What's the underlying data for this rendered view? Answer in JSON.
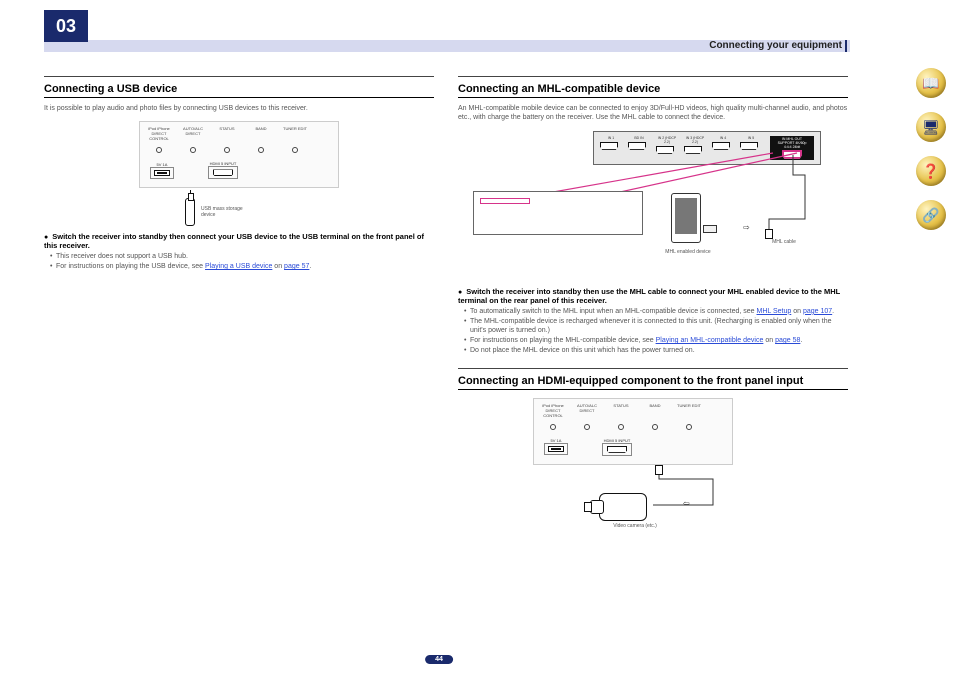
{
  "header": {
    "chapter_num": "03",
    "chapter_title": "Connecting your equipment"
  },
  "page_number": "44",
  "left": {
    "h_usb": "Connecting a USB device",
    "usb_intro": "It is possible to play audio and photo files by connecting USB devices to this receiver.",
    "usb_diagram": {
      "ports": [
        "iPod iPhone DIRECT CONTROL",
        "AUTO/ALC DIRECT",
        "STATUS",
        "BAND",
        "TUNER EDIT"
      ],
      "usb_label": "5V 1A",
      "hdmi_label": "HDMI 5 INPUT",
      "device_caption": "USB mass storage device"
    },
    "usb_bold": "Switch the receiver into standby then connect your USB device to the USB terminal on the front panel of this receiver.",
    "usb_notes": [
      {
        "pre": "This receiver does not support a USB hub."
      },
      {
        "pre": "For instructions on playing the USB device, see ",
        "link": "Playing a USB device",
        "mid": " on ",
        "link2": "page 57",
        "post": "."
      }
    ]
  },
  "right": {
    "h_mhl": "Connecting an MHL-compatible device",
    "mhl_intro": "An MHL-compatible mobile device can be connected to enjoy 3D/Full-HD videos, high quality multi-channel audio, and photos etc., with charge the battery on the receiver. Use the MHL cable to connect the device.",
    "mhl_diagram": {
      "ports": [
        "IN 1",
        "BD IN",
        "IN 2 (HDCP 2.2)",
        "IN 3 (HDCP 2.2)",
        "IN 4",
        "IN 5"
      ],
      "mhl_port_label": "IN   MHL  OUT\nSUPPORT 4K/60p\n4:4:4 24bit",
      "phone_caption": "MHL enabled device",
      "cable_caption": "MHL cable"
    },
    "mhl_bold": "Switch the receiver into standby then use the MHL cable to connect your MHL enabled device to the MHL terminal on the rear panel of this receiver.",
    "mhl_notes": [
      {
        "pre": "To automatically switch to the MHL input when an MHL-compatible device is connected, see ",
        "link": "MHL Setup",
        "mid": " on ",
        "link2": "page 107",
        "post": "."
      },
      {
        "pre": "The MHL-compatible device is recharged whenever it is connected to this unit. (Recharging is enabled only when the unit's power is turned on.)"
      },
      {
        "pre": "For instructions on playing the MHL-compatible device, see ",
        "link": "Playing an MHL-compatible device",
        "mid": " on ",
        "link2": "page 58",
        "post": "."
      },
      {
        "pre": "Do not place the MHL device on this unit which has the power turned on."
      }
    ],
    "h_hdmi": "Connecting an HDMI-equipped component to the front panel input",
    "hdmi_diagram": {
      "ports": [
        "iPod iPhone DIRECT CONTROL",
        "AUTO/ALC DIRECT",
        "STATUS",
        "BAND",
        "TUNER EDIT"
      ],
      "usb_label": "5V 1A",
      "hdmi_label": "HDMI 5 INPUT",
      "device_caption": "Video camera (etc.)"
    }
  },
  "sidebar": {
    "icons": [
      "book-icon",
      "register-icon",
      "help-icon",
      "network-icon"
    ],
    "glyphs": [
      "📖",
      "🖥",
      "❓",
      "🔗"
    ]
  }
}
